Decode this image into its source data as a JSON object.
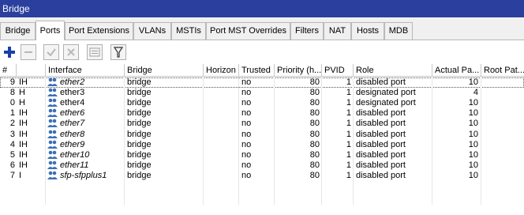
{
  "window": {
    "title": "Bridge"
  },
  "tabs": [
    {
      "label": "Bridge",
      "active": false
    },
    {
      "label": "Ports",
      "active": true
    },
    {
      "label": "Port Extensions",
      "active": false
    },
    {
      "label": "VLANs",
      "active": false
    },
    {
      "label": "MSTIs",
      "active": false
    },
    {
      "label": "Port MST Overrides",
      "active": false
    },
    {
      "label": "Filters",
      "active": false
    },
    {
      "label": "NAT",
      "active": false
    },
    {
      "label": "Hosts",
      "active": false
    },
    {
      "label": "MDB",
      "active": false
    }
  ],
  "toolbar": {
    "buttons": [
      {
        "name": "add-button",
        "icon": "plus-icon",
        "enabled": true
      },
      {
        "name": "remove-button",
        "icon": "minus-icon",
        "enabled": false
      },
      {
        "name": "enable-button",
        "icon": "check-icon",
        "enabled": false
      },
      {
        "name": "disable-button",
        "icon": "cross-icon",
        "enabled": false
      },
      {
        "name": "comment-button",
        "icon": "comment-icon",
        "enabled": false
      },
      {
        "name": "filter-button",
        "icon": "filter-icon",
        "enabled": true
      }
    ]
  },
  "table": {
    "columns": [
      "#",
      "",
      "Interface",
      "Bridge",
      "Horizon",
      "Trusted",
      "Priority (h...",
      "PVID",
      "Role",
      "Actual Pa...",
      "Root Pat..."
    ],
    "rows": [
      {
        "num": "9",
        "flags": "IH",
        "iface": "ether2",
        "italic": true,
        "bridge": "bridge",
        "horizon": "",
        "trusted": "no",
        "priority": "80",
        "pvid": "1",
        "role": "disabled port",
        "actual": "10",
        "root": "",
        "selected": true
      },
      {
        "num": "8",
        "flags": "H",
        "iface": "ether3",
        "italic": false,
        "bridge": "bridge",
        "horizon": "",
        "trusted": "no",
        "priority": "80",
        "pvid": "1",
        "role": "designated port",
        "actual": "4",
        "root": "",
        "selected": false
      },
      {
        "num": "0",
        "flags": "H",
        "iface": "ether4",
        "italic": false,
        "bridge": "bridge",
        "horizon": "",
        "trusted": "no",
        "priority": "80",
        "pvid": "1",
        "role": "designated port",
        "actual": "10",
        "root": "",
        "selected": false
      },
      {
        "num": "1",
        "flags": "IH",
        "iface": "ether6",
        "italic": true,
        "bridge": "bridge",
        "horizon": "",
        "trusted": "no",
        "priority": "80",
        "pvid": "1",
        "role": "disabled port",
        "actual": "10",
        "root": "",
        "selected": false
      },
      {
        "num": "2",
        "flags": "IH",
        "iface": "ether7",
        "italic": true,
        "bridge": "bridge",
        "horizon": "",
        "trusted": "no",
        "priority": "80",
        "pvid": "1",
        "role": "disabled port",
        "actual": "10",
        "root": "",
        "selected": false
      },
      {
        "num": "3",
        "flags": "IH",
        "iface": "ether8",
        "italic": true,
        "bridge": "bridge",
        "horizon": "",
        "trusted": "no",
        "priority": "80",
        "pvid": "1",
        "role": "disabled port",
        "actual": "10",
        "root": "",
        "selected": false
      },
      {
        "num": "4",
        "flags": "IH",
        "iface": "ether9",
        "italic": true,
        "bridge": "bridge",
        "horizon": "",
        "trusted": "no",
        "priority": "80",
        "pvid": "1",
        "role": "disabled port",
        "actual": "10",
        "root": "",
        "selected": false
      },
      {
        "num": "5",
        "flags": "IH",
        "iface": "ether10",
        "italic": true,
        "bridge": "bridge",
        "horizon": "",
        "trusted": "no",
        "priority": "80",
        "pvid": "1",
        "role": "disabled port",
        "actual": "10",
        "root": "",
        "selected": false
      },
      {
        "num": "6",
        "flags": "IH",
        "iface": "ether11",
        "italic": true,
        "bridge": "bridge",
        "horizon": "",
        "trusted": "no",
        "priority": "80",
        "pvid": "1",
        "role": "disabled port",
        "actual": "10",
        "root": "",
        "selected": false
      },
      {
        "num": "7",
        "flags": "I",
        "iface": "sfp-sfpplus1",
        "italic": true,
        "bridge": "bridge",
        "horizon": "",
        "trusted": "no",
        "priority": "80",
        "pvid": "1",
        "role": "disabled port",
        "actual": "10",
        "root": "",
        "selected": false
      }
    ]
  },
  "colors": {
    "titlebar": "#2b3f9e",
    "add_icon": "#1a3fa8",
    "interface_icon": "#3b6fb6"
  }
}
